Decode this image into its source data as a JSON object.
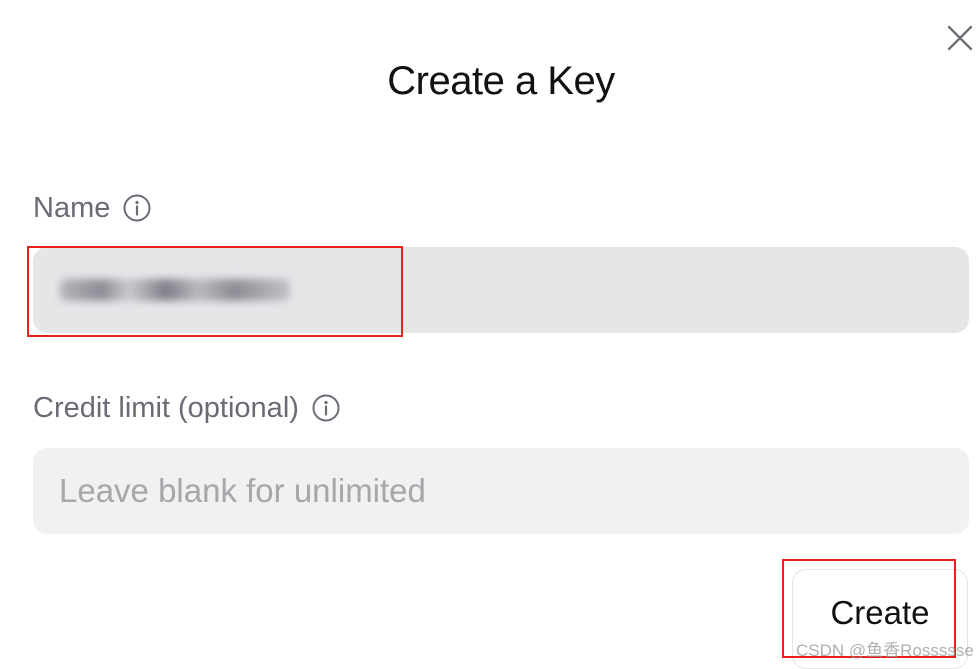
{
  "dialog": {
    "title": "Create a Key",
    "close_icon": "close-icon"
  },
  "name_field": {
    "label": "Name",
    "info_icon": "info-icon",
    "value_obscured": true
  },
  "credit_field": {
    "label": "Credit limit (optional)",
    "info_icon": "info-icon",
    "placeholder": "Leave blank for unlimited",
    "value": ""
  },
  "actions": {
    "create_label": "Create"
  },
  "annotations": {
    "highlight_color": "#e8211c"
  },
  "watermark": {
    "text": "CSDN @鱼香Rossssse"
  }
}
